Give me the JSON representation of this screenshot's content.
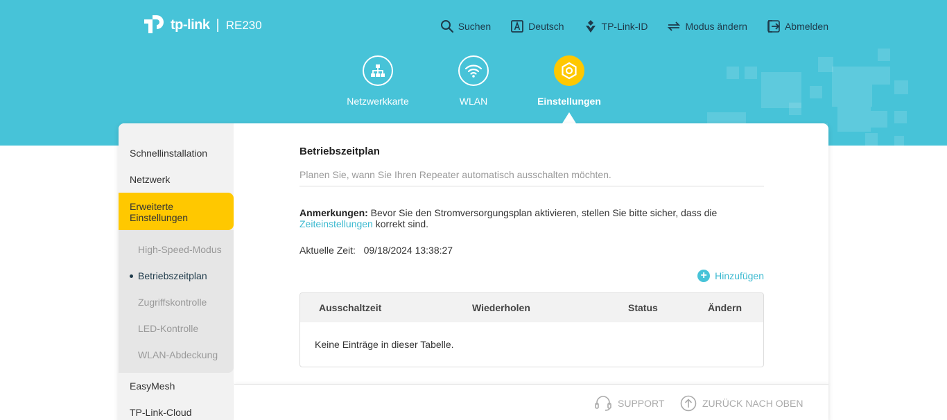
{
  "header": {
    "brand": "tp-link",
    "model": "RE230",
    "nav": [
      {
        "label": "Suchen",
        "icon": "search-icon"
      },
      {
        "label": "Deutsch",
        "icon": "language-icon"
      },
      {
        "label": "TP-Link-ID",
        "icon": "tplink-id-icon"
      },
      {
        "label": "Modus ändern",
        "icon": "mode-switch-icon"
      },
      {
        "label": "Abmelden",
        "icon": "logout-icon"
      }
    ]
  },
  "tabs": [
    {
      "label": "Netzwerkkarte",
      "icon": "network-map-icon"
    },
    {
      "label": "WLAN",
      "icon": "wifi-icon"
    },
    {
      "label": "Einstellungen",
      "icon": "settings-icon",
      "active": true
    }
  ],
  "sidebar": {
    "items": [
      "Schnellinstallation",
      "Netzwerk",
      "Erweiterte Einstellungen",
      "EasyMesh",
      "TP-Link-Cloud"
    ],
    "sub_items": [
      "High-Speed-Modus",
      "Betriebszeitplan",
      "Zugriffskontrolle",
      "LED-Kontrolle",
      "WLAN-Abdeckung"
    ],
    "active_item": "Erweiterte Einstellungen",
    "active_sub_item": "Betriebszeitplan"
  },
  "content": {
    "title": "Betriebszeitplan",
    "description": "Planen Sie, wann Sie Ihren Repeater automatisch ausschalten möchten.",
    "note_label": "Anmerkungen:",
    "note_text_1": " Bevor Sie den Stromversorgungsplan aktivieren, stellen Sie bitte sicher, dass die ",
    "note_link": "Zeiteinstellungen",
    "note_text_2": " korrekt sind.",
    "time_label": "Aktuelle Zeit:",
    "time_value": "09/18/2024 13:38:27",
    "add_label": "Hinzufügen",
    "table": {
      "columns": [
        "Ausschaltzeit",
        "Wiederholen",
        "Status",
        "Ändern"
      ],
      "empty_text": "Keine Einträge in dieser Tabelle."
    }
  },
  "footer": {
    "support": "SUPPORT",
    "back_to_top": "ZURÜCK NACH OBEN"
  },
  "colors": {
    "header_bg": "#47c3d8",
    "accent_yellow": "#ffc800",
    "link": "#3bb9d0",
    "sidebar_bg": "#f2f2f2"
  }
}
